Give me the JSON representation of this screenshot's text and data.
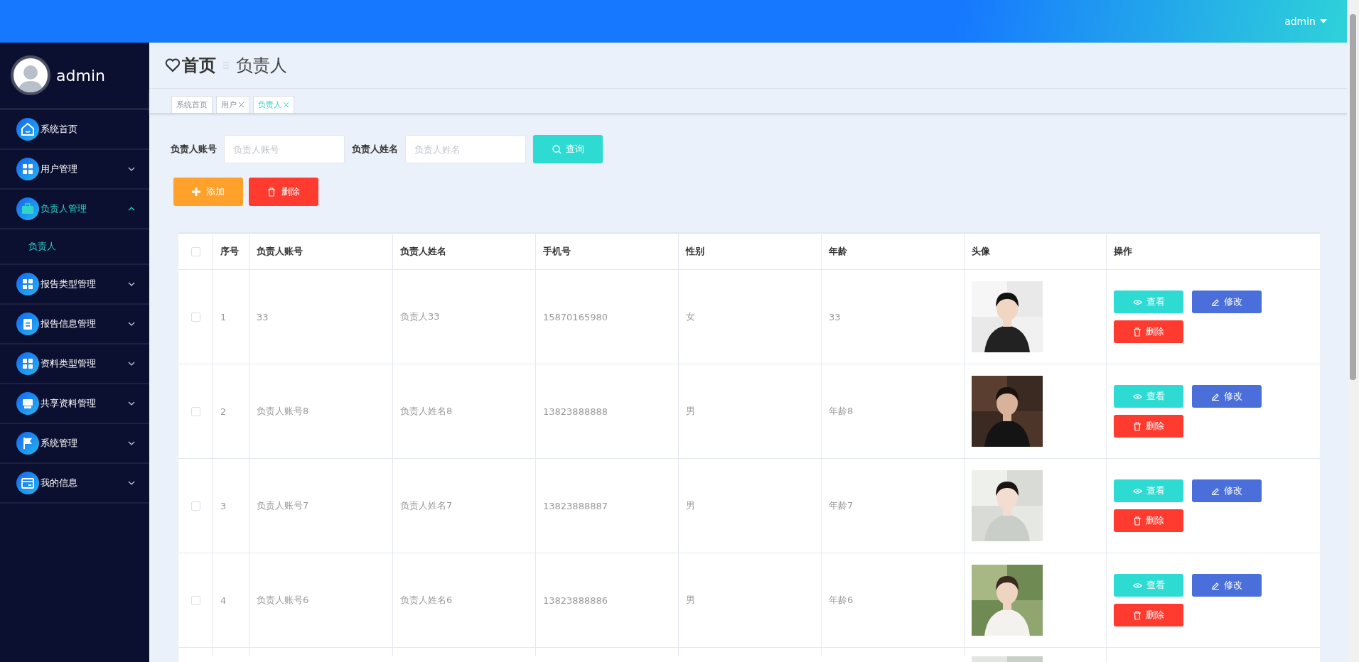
{
  "top_bar": {
    "user": "admin"
  },
  "sidebar": {
    "user": "admin",
    "items": [
      {
        "label": "系统首页",
        "kind": "link"
      },
      {
        "label": "用户管理",
        "kind": "menu",
        "expanded": false
      },
      {
        "label": "负责人管理",
        "kind": "menu",
        "expanded": true,
        "children": [
          {
            "label": "负责人",
            "selected": true
          }
        ]
      },
      {
        "label": "报告类型管理",
        "kind": "menu",
        "expanded": false
      },
      {
        "label": "报告信息管理",
        "kind": "menu",
        "expanded": false
      },
      {
        "label": "资料类型管理",
        "kind": "menu",
        "expanded": false
      },
      {
        "label": "共享资料管理",
        "kind": "menu",
        "expanded": false
      },
      {
        "label": "系统管理",
        "kind": "menu",
        "expanded": false
      },
      {
        "label": "我的信息",
        "kind": "menu",
        "expanded": false
      }
    ]
  },
  "breadcrumb": {
    "home": "首页",
    "current": "负责人"
  },
  "tabs": [
    {
      "label": "系统首页",
      "closable": false,
      "selected": false
    },
    {
      "label": "用户",
      "closable": true,
      "selected": false
    },
    {
      "label": "负责人",
      "closable": true,
      "selected": true
    }
  ],
  "search": {
    "fields": [
      {
        "label": "负责人账号",
        "placeholder": "负责人账号"
      },
      {
        "label": "负责人姓名",
        "placeholder": "负责人姓名"
      }
    ],
    "button": "查询"
  },
  "toolbar": [
    {
      "kind": "add",
      "label": "添加"
    },
    {
      "kind": "delete",
      "label": "删除"
    }
  ],
  "table": {
    "all_checked": false,
    "columns": [
      "序号",
      "负责人账号",
      "负责人姓名",
      "手机号",
      "性别",
      "年龄",
      "头像",
      "操作"
    ],
    "rows": [
      {
        "checked": false,
        "cells": [
          "1",
          "33",
          "负责人33",
          "15870165980",
          "女",
          "33"
        ],
        "avatar": {
          "kind": "picture"
        },
        "actions": [
          {
            "kind": "view",
            "label": "查看"
          },
          {
            "kind": "edit",
            "label": "修改"
          },
          {
            "kind": "delete",
            "label": "删除"
          }
        ]
      },
      {
        "checked": false,
        "cells": [
          "2",
          "负责人账号8",
          "负责人姓名8",
          "13823888888",
          "男",
          "年龄8"
        ],
        "avatar": {
          "kind": "picture"
        },
        "actions": [
          {
            "kind": "view",
            "label": "查看"
          },
          {
            "kind": "edit",
            "label": "修改"
          },
          {
            "kind": "delete",
            "label": "删除"
          }
        ]
      },
      {
        "checked": false,
        "cells": [
          "3",
          "负责人账号7",
          "负责人姓名7",
          "13823888887",
          "男",
          "年龄7"
        ],
        "avatar": {
          "kind": "picture"
        },
        "actions": [
          {
            "kind": "view",
            "label": "查看"
          },
          {
            "kind": "edit",
            "label": "修改"
          },
          {
            "kind": "delete",
            "label": "删除"
          }
        ]
      },
      {
        "checked": false,
        "cells": [
          "4",
          "负责人账号6",
          "负责人姓名6",
          "13823888886",
          "男",
          "年龄6"
        ],
        "avatar": {
          "kind": "picture"
        },
        "actions": [
          {
            "kind": "view",
            "label": "查看"
          },
          {
            "kind": "edit",
            "label": "修改"
          },
          {
            "kind": "delete",
            "label": "删除"
          }
        ]
      },
      {
        "cells": [],
        "avatar": {
          "kind": "picture"
        },
        "actions": []
      }
    ]
  }
}
